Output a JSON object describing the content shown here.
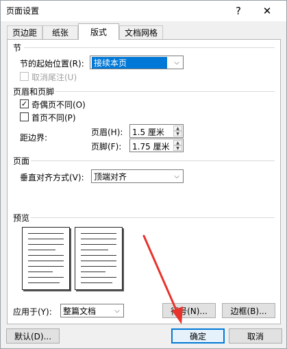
{
  "window": {
    "title": "页面设置",
    "help_label": "?",
    "close_label": "✕"
  },
  "tabs": [
    {
      "label": "页边距"
    },
    {
      "label": "纸张"
    },
    {
      "label": "版式"
    },
    {
      "label": "文档网格"
    }
  ],
  "section_start": {
    "heading": "节",
    "start_label": "节的起始位置(R):",
    "start_value": "接续本页",
    "suppress_endnotes_label": "取消尾注(U)"
  },
  "headers_footers": {
    "heading": "页眉和页脚",
    "odd_even_label": "奇偶页不同(O)",
    "odd_even_checked": true,
    "first_page_label": "首页不同(P)",
    "first_page_checked": false,
    "from_edge_label": "距边界:",
    "header_label": "页眉(H):",
    "header_value": "1.5 厘米",
    "footer_label": "页脚(F):",
    "footer_value": "1.75 厘米"
  },
  "page_section": {
    "heading": "页面",
    "valign_label": "垂直对齐方式(V):",
    "valign_value": "顶端对齐"
  },
  "preview": {
    "heading": "预览"
  },
  "apply": {
    "label": "应用于(Y):",
    "value": "整篇文档",
    "line_numbers_label": "行号(N)...",
    "borders_label": "边框(B)..."
  },
  "footer": {
    "default_label": "默认(D)...",
    "ok_label": "确定",
    "cancel_label": "取消"
  },
  "colors": {
    "accent": "#0078d7",
    "annotation_arrow": "#e8322b"
  }
}
